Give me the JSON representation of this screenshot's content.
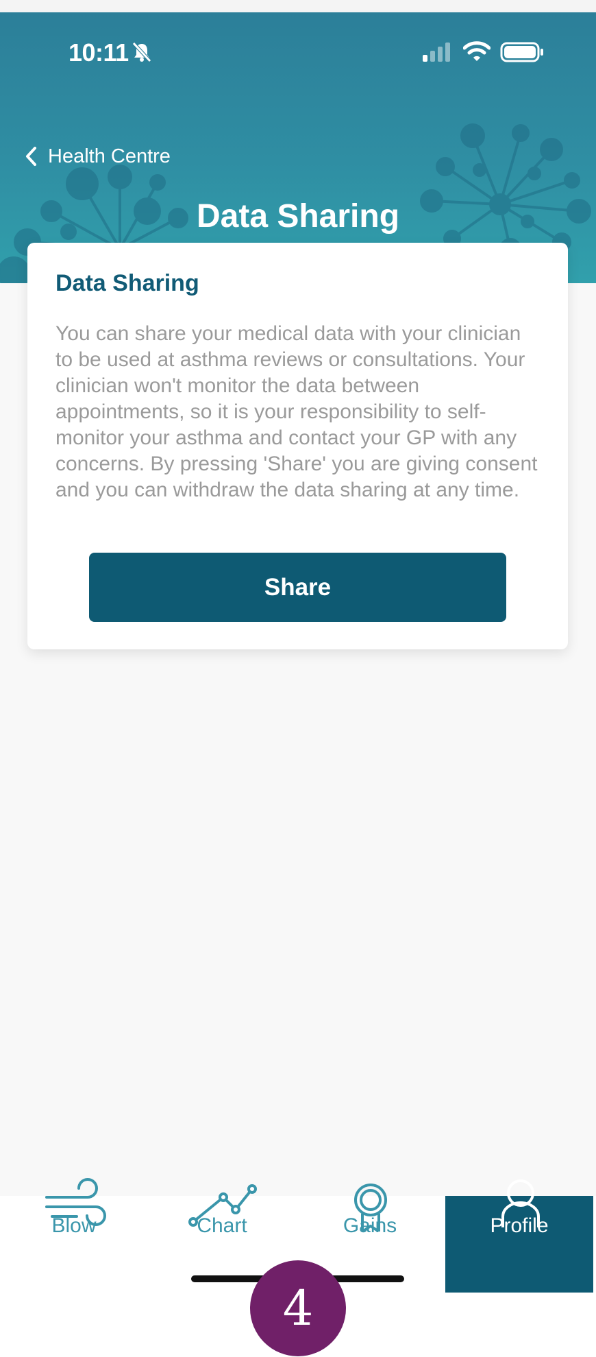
{
  "status_bar": {
    "time": "10:11",
    "icons": [
      "bell-slash-icon",
      "signal-icon",
      "wifi-icon",
      "battery-icon"
    ]
  },
  "header": {
    "back_label": "Health Centre",
    "title": "Data Sharing"
  },
  "card": {
    "title": "Data Sharing",
    "body": "You can share your medical data with your clinician to be used at asthma reviews or consultations. Your clinician won't monitor the data between appointments, so it is your responsibility to self-monitor your asthma and contact your GP with any concerns. By pressing 'Share' you are giving consent and you can withdraw the data sharing at any time.",
    "button_label": "Share"
  },
  "tabs": [
    {
      "label": "Blow",
      "icon": "wind-icon",
      "active": false
    },
    {
      "label": "Chart",
      "icon": "line-chart-icon",
      "active": false
    },
    {
      "label": "Gains",
      "icon": "award-icon",
      "active": false
    },
    {
      "label": "Profile",
      "icon": "user-icon",
      "active": true
    }
  ],
  "badge": {
    "value": "4"
  },
  "colors": {
    "header_teal": "#2f8ea3",
    "primary_dark": "#0e5a73",
    "tab_icon": "#3a96ab",
    "badge_purple": "#702068",
    "body_text": "#9a9a9a"
  }
}
